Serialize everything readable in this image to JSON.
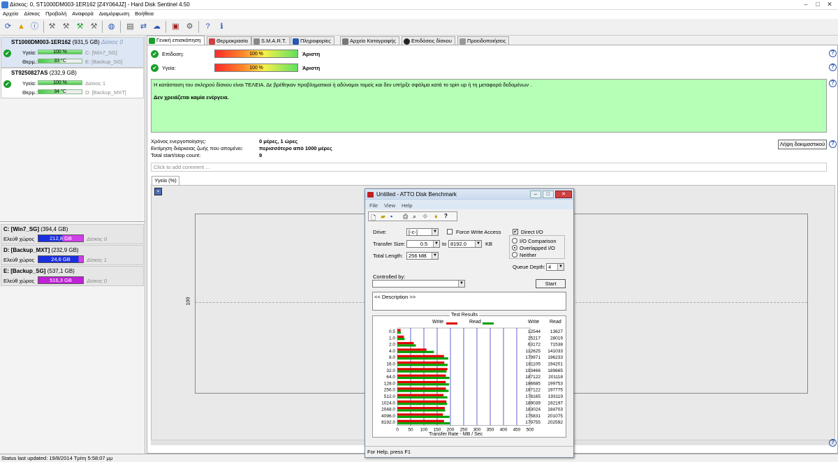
{
  "window": {
    "title": "Δίσκος: 0, ST1000DM003-1ER162 [Z4Y064JZ]  -  Hard Disk Sentinel 4.50"
  },
  "menu": [
    "Αρχείο",
    "Δίσκος",
    "Προβολή",
    "Αναφορά",
    "Διαμόρφωση",
    "Βοήθεια"
  ],
  "disks": [
    {
      "name": "ST1000DM003-1ER162",
      "size": "(931,5 GB)",
      "disk_label": "Δίσκος 0",
      "health_label": "Υγεία:",
      "health": "100 %",
      "health_pct": 100,
      "temp_label": "Θερμ.:",
      "temp": "33 °C",
      "temp_pct": 55,
      "volumes": [
        "C: [Win7_SG]",
        "E: [Backup_SG]"
      ]
    },
    {
      "name": "ST9250827AS",
      "size": "(232,9 GB)",
      "disk_label": "Δίσκος 1",
      "health_label": "Υγεία:",
      "health": "100 %",
      "health_pct": 100,
      "temp_label": "Θερμ.:",
      "temp": "34 °C",
      "temp_pct": 57,
      "volumes": [
        "D: [Backup_MXT]"
      ]
    }
  ],
  "volumes": [
    {
      "name": "C: [Win7_SG]",
      "size": "(394,4 GB)",
      "free_label": "Ελεύθ χώρος",
      "free": "212,8 GB",
      "free_pct": 54,
      "disk": "Δίσκος 0",
      "color": "#1a2fe0"
    },
    {
      "name": "D: [Backup_MXT]",
      "size": "(232,9 GB)",
      "free_label": "Ελεύθ χώρος",
      "free": "24,6 GB",
      "free_pct": 90,
      "disk": "Δίσκος 1",
      "color": "#1a2fe0"
    },
    {
      "name": "E: [Backup_SG]",
      "size": "(537,1 GB)",
      "free_label": "Ελεύθ χώρος",
      "free": "516,3 GB",
      "free_pct": 100,
      "disk": "Δίσκος 0",
      "color": "#c020d8"
    }
  ],
  "tabs": [
    "Γενική επισκόπηση",
    "Θερμοκρασία",
    "S.M.A.R.T.",
    "Πληροφορίες",
    "Αρχείο Καταγραφής",
    "Επιδόσεις δίσκου",
    "Προειδοποιήσεις"
  ],
  "overview": {
    "performance_label": "Επίδοση:",
    "performance": "100 %",
    "performance_pct": 100,
    "performance_rating": "Άριστη",
    "health_label": "Υγεία:",
    "health": "100 %",
    "health_pct": 100,
    "health_rating": "Άριστη",
    "status_text": "Η κατάσταση του σκληρού δίσκου είναι ΤΕΛΕΙΑ. Δε βρέθηκαν προβληματικοί ή αδύναμοι τομείς και δεν υπήρξε σφάλμα κατά το spin up ή τη μεταφορά δεδομένων .",
    "status_action": "Δεν χρειάζεται καμία ενέργεια.",
    "power_on_label": "Χρόνος ενεργοποίησης:",
    "power_on": "0 μέρες, 1 ώρες",
    "lifetime_label": "Εκτίμηση διάρκειας ζωής που απομένει:",
    "lifetime": "περισσότερο από 1000 μέρες",
    "startstop_label": "Total start/stop count:",
    "startstop": "9",
    "test_button": "Λήψη δοκιμαστικού",
    "comment_placeholder": "Click to add comment ...",
    "chart_tab": "Υγεία (%)",
    "chart_y_tick": "100"
  },
  "status_bar": "Status last updated: 19/8/2014 Τρίτη 5:58:07 μμ",
  "atto": {
    "title": "Untitled - ATTO Disk Benchmark",
    "menu": [
      "File",
      "View",
      "Help"
    ],
    "drive_label": "Drive:",
    "drive": "[-c-]",
    "force_write": "Force Write Access",
    "direct_io": "Direct I/O",
    "transfer_label": "Transfer Size:",
    "transfer_from": "0.5",
    "to_label": "to",
    "transfer_to": "8192.0",
    "kb": "KB",
    "length_label": "Total Length:",
    "length": "256 MB",
    "io_comparison": "I/O Comparison",
    "overlapped": "Overlapped I/O",
    "neither": "Neither",
    "queue_label": "Queue Depth:",
    "queue": "4",
    "controlled_label": "Controlled by:",
    "start": "Start",
    "description": "<< Description >>",
    "results_title": "Test Results",
    "write_label": "Write",
    "read_label": "Read",
    "col_write": "Write",
    "col_read": "Read",
    "xlabel": "Transfer Rate - MB / Sec",
    "status": "For Help, press F1"
  },
  "chart_data": {
    "type": "bar",
    "title": "Test Results",
    "xlabel": "Transfer Rate - MB / Sec",
    "categories": [
      "0.5",
      "1.0",
      "2.0",
      "4.0",
      "8.0",
      "16.0",
      "32.0",
      "64.0",
      "128.0",
      "256.0",
      "512.0",
      "1024.0",
      "2048.0",
      "4096.0",
      "8192.0"
    ],
    "series": [
      {
        "name": "Write",
        "color": "#e00000",
        "values": [
          12544,
          25217,
          63172,
          112625,
          179971,
          181105,
          193466,
          187122,
          186685,
          187122,
          178165,
          189039,
          183024,
          175831,
          179755
        ]
      },
      {
        "name": "Read",
        "color": "#00a000",
        "values": [
          13627,
          28019,
          71538,
          141033,
          196233,
          194201,
          189665,
          201118,
          199753,
          197775,
          193119,
          192197,
          184703,
          201075,
          202592
        ]
      }
    ],
    "xticks": [
      "0",
      "50",
      "100",
      "150",
      "200",
      "250",
      "300",
      "350",
      "400",
      "450",
      "500"
    ],
    "xlim": [
      0,
      500
    ]
  }
}
